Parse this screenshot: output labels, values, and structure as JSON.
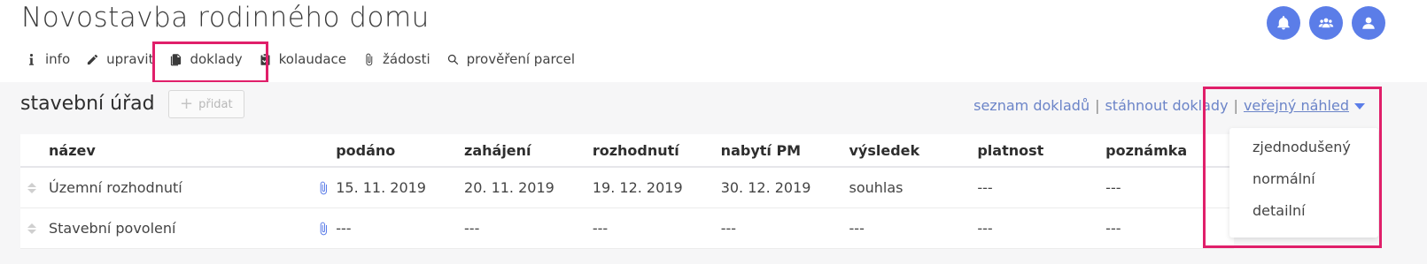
{
  "header": {
    "title": "Novostavba rodinného domu"
  },
  "top_actions": [
    {
      "name": "notifications-button",
      "icon": "bell-icon"
    },
    {
      "name": "users-button",
      "icon": "users-icon"
    },
    {
      "name": "profile-button",
      "icon": "user-icon"
    }
  ],
  "tabs": [
    {
      "label": "info",
      "icon": "info-icon"
    },
    {
      "label": "upravit",
      "icon": "pencil-icon"
    },
    {
      "label": "doklady",
      "icon": "documents-icon"
    },
    {
      "label": "kolaudace",
      "icon": "clipboard-check-icon"
    },
    {
      "label": "žádosti",
      "icon": "paperclip-icon"
    },
    {
      "label": "prověření parcel",
      "icon": "search-icon"
    }
  ],
  "section": {
    "title": "stavební úřad",
    "add_label": "přidat"
  },
  "links": {
    "list": "seznam dokladů",
    "download": "stáhnout doklady",
    "separator": "|",
    "public_view": "veřejný náhled"
  },
  "table": {
    "columns": [
      "název",
      "podáno",
      "zahájení",
      "rozhodnutí",
      "nabytí PM",
      "výsledek",
      "platnost",
      "poznámka"
    ],
    "rows": [
      {
        "name": "Územní rozhodnutí",
        "cells": [
          "15. 11. 2019",
          "20. 11. 2019",
          "19. 12. 2019",
          "30. 12. 2019",
          "souhlas",
          "---",
          "---"
        ]
      },
      {
        "name": "Stavební povolení",
        "cells": [
          "---",
          "---",
          "---",
          "---",
          "---",
          "---",
          "---"
        ]
      }
    ]
  },
  "dropdown": {
    "options": [
      "zjednodušený",
      "normální",
      "detailní"
    ]
  },
  "colors": {
    "accent": "#5b7de8",
    "highlight": "#e01f6a",
    "link": "#6b84c8"
  }
}
